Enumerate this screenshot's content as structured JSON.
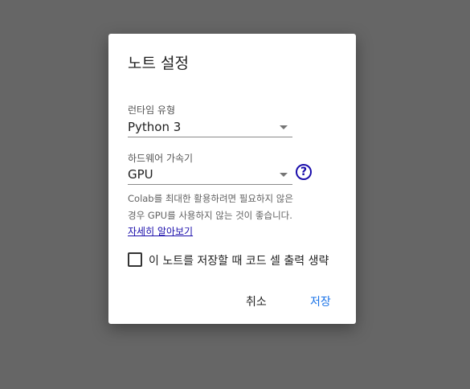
{
  "dialog": {
    "title": "노트 설정",
    "runtime": {
      "label": "런타임 유형",
      "value": "Python 3"
    },
    "accelerator": {
      "label": "하드웨어 가속기",
      "value": "GPU",
      "help_icon": "help-circle-icon",
      "help_glyph": "?"
    },
    "info_lines": [
      "Colab를 최대한 활용하려면 필요하지 않은",
      "경우 GPU를 사용하지 않는 것이 좋습니다."
    ],
    "learn_more": "자세히 알아보기",
    "omit_output_checkbox": {
      "label": "이 노트를 저장할 때 코드 셀 출력 생략",
      "checked": false
    },
    "buttons": {
      "cancel": "취소",
      "save": "저장"
    }
  },
  "colors": {
    "backdrop": "#666666",
    "primary": "#1a73e8",
    "link": "#1a0dab"
  }
}
